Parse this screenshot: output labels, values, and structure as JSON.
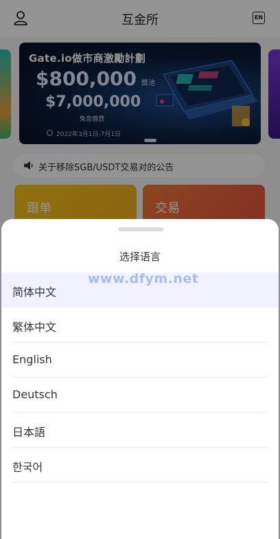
{
  "header": {
    "title": "互金所",
    "user_icon": "user-icon",
    "lang_icon_text": "EN"
  },
  "banner": {
    "title": "Gate.io做市商激勵計劃",
    "amount_primary": "$800,000",
    "amount_primary_unit": "獎池",
    "amount_secondary": "$7,000,000",
    "amount_secondary_note": "免息借貸",
    "date_range": "2022年3月1日-7月1日"
  },
  "notice": {
    "icon": "speaker-icon",
    "text": "关于移除SGB/USDT交易对的公告"
  },
  "cards": [
    {
      "label": "跟单"
    },
    {
      "label": "交易"
    }
  ],
  "language_sheet": {
    "title": "选择语言",
    "watermark": "www.dfym.net",
    "options": [
      {
        "label": "简体中文",
        "selected": true
      },
      {
        "label": "繁体中文",
        "selected": false
      },
      {
        "label": "English",
        "selected": false
      },
      {
        "label": "Deutsch",
        "selected": false
      },
      {
        "label": "日本語",
        "selected": false
      },
      {
        "label": "한국어",
        "selected": false
      }
    ]
  },
  "colors": {
    "selected_row_bg": "#eef3ff",
    "overlay": "rgba(0,0,0,0.42)",
    "follow_card": "#f6c21a",
    "trade_card": "#ea5a3a"
  }
}
